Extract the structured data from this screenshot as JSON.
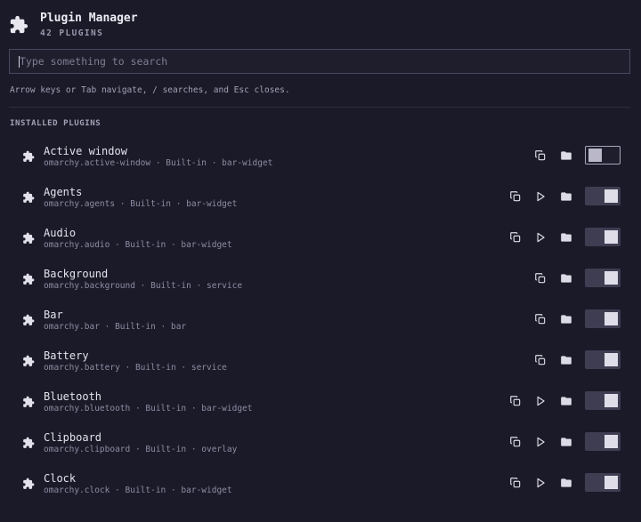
{
  "header": {
    "title": "Plugin Manager",
    "count": "42 PLUGINS",
    "icon": "puzzle-icon"
  },
  "search": {
    "value": "",
    "placeholder": "Type something to search"
  },
  "hint": "Arrow keys or Tab navigate, / searches, and Esc closes.",
  "section_label": "INSTALLED PLUGINS",
  "colors": {
    "background": "#1b1a28",
    "toggle_track_on": "#3f3d52",
    "toggle_knob": "#dedde8"
  },
  "plugins": [
    {
      "name": "Active window",
      "meta": "omarchy.active-window · Built-in · bar-widget",
      "has_run": false,
      "enabled": false
    },
    {
      "name": "Agents",
      "meta": "omarchy.agents · Built-in · bar-widget",
      "has_run": true,
      "enabled": true
    },
    {
      "name": "Audio",
      "meta": "omarchy.audio · Built-in · bar-widget",
      "has_run": true,
      "enabled": true
    },
    {
      "name": "Background",
      "meta": "omarchy.background · Built-in · service",
      "has_run": false,
      "enabled": true
    },
    {
      "name": "Bar",
      "meta": "omarchy.bar · Built-in · bar",
      "has_run": false,
      "enabled": true
    },
    {
      "name": "Battery",
      "meta": "omarchy.battery · Built-in · service",
      "has_run": false,
      "enabled": true
    },
    {
      "name": "Bluetooth",
      "meta": "omarchy.bluetooth · Built-in · bar-widget",
      "has_run": true,
      "enabled": true
    },
    {
      "name": "Clipboard",
      "meta": "omarchy.clipboard · Built-in · overlay",
      "has_run": true,
      "enabled": true
    },
    {
      "name": "Clock",
      "meta": "omarchy.clock · Built-in · bar-widget",
      "has_run": true,
      "enabled": true
    }
  ]
}
